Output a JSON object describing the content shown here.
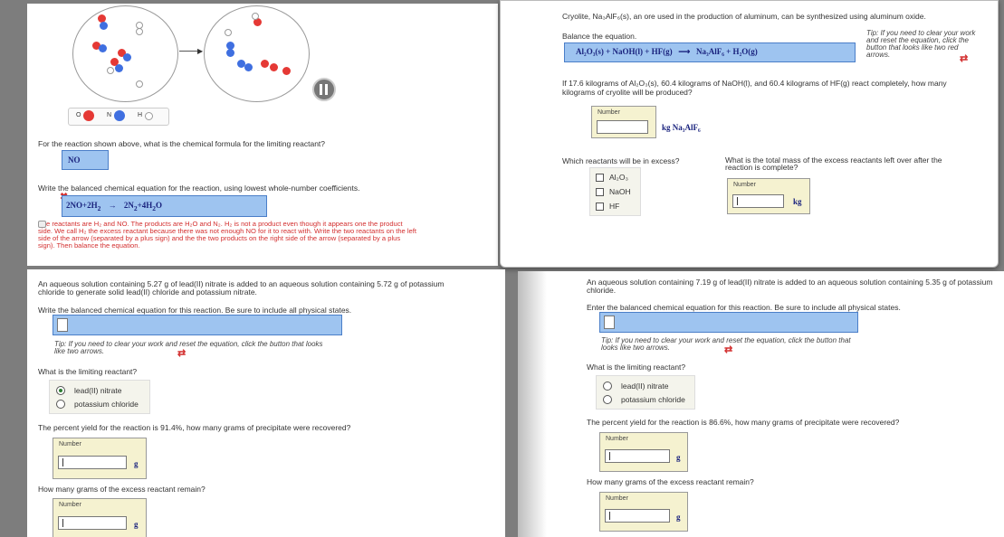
{
  "colors": {
    "blue_fill": "#9ec4f0",
    "number_box": "#f5f2d0",
    "error_red": "#d32f2f",
    "radio_selected": "#2e7d32"
  },
  "p1": {
    "legend": {
      "o": "O",
      "n": "N",
      "h": "H"
    },
    "q1": "For the reaction shown above, what is the chemical formula for the limiting reactant?",
    "a1": "NO",
    "q2": "Write the balanced chemical equation for the reaction, using lowest whole-number coefficients.",
    "eq_left": "2NO+2H",
    "eq_left_sub": "2",
    "eq_arrow": "→",
    "eq_right": "2N",
    "eq_right_sub": "2",
    "eq_right2": "+4H",
    "eq_right2_sub": "2",
    "eq_right3": "O",
    "feedback": "e reactants are H₂ and NO. The products are H₂O and N₂. H₂ is not a product even though it appears one the product side. We call H₂ the excess reactant because there was not enough NO for it to react with. Write the two reactants on the left side of the arrow (separated by a plus sign) and the the two products on the right side of the arrow (separated by a plus sign). Then balance the equation.",
    "pause_icon": "pause-icon"
  },
  "p2": {
    "intro": "Cryolite, Na₃AlF₆(s), an ore used in the production of aluminum, can be synthesized using aluminum oxide.",
    "balance": "Balance the equation.",
    "tip": "Tip: If you need to clear your work and reset the equation, click the button that looks like two red arrows.",
    "equation": "Al₂O₃(s) + NaOH(l) + HF(g)   ⟶   Na₃AlF₆ + H₂O(g)",
    "q1": "If 17.6 kilograms of Al₂O₃(s), 60.4 kilograms of NaOH(l), and 60.4 kilograms of HF(g) react completely, how many kilograms of cryolite will be produced?",
    "number_label": "Number",
    "unit1": "kg  Na₃AlF₆",
    "q2": "Which reactants will be in excess?",
    "checks": [
      "Al₂O₃",
      "NaOH",
      "HF"
    ],
    "q3": "What is the total mass of the excess reactants left over after the reaction is complete?",
    "unit2": "kg"
  },
  "p3": {
    "intro": "An aqueous solution containing 5.27 g of lead(II) nitrate is added to an aqueous solution containing 5.72 g of potassium chloride to generate solid lead(II) chloride and potassium nitrate.",
    "q1": "Write the balanced chemical equation for this reaction. Be sure to include all physical states.",
    "tip": "Tip: If you need to clear your work and reset the equation, click the button that looks like two arrows.",
    "q2": "What is the limiting reactant?",
    "options": [
      "lead(II) nitrate",
      "potassium chloride"
    ],
    "q3": "The percent yield for the reaction is 91.4%, how many grams of precipitate were recovered?",
    "number_label": "Number",
    "unit": "g",
    "q4": "How many grams of the excess reactant remain?"
  },
  "p4": {
    "intro": "An aqueous solution containing 7.19 g of lead(II) nitrate is added to an aqueous solution containing 5.35 g of potassium chloride.",
    "q1": "Enter the balanced chemical equation for this reaction. Be sure to include all physical states.",
    "tip": "Tip: If you need to clear your work and reset the equation, click the button that looks like two arrows.",
    "q2": "What is the limiting reactant?",
    "options": [
      "lead(II) nitrate",
      "potassium chloride"
    ],
    "q3": "The percent yield for the reaction is 86.6%, how many grams of precipitate were recovered?",
    "number_label": "Number",
    "unit": "g",
    "q4": "How many grams of the excess reactant remain?"
  }
}
